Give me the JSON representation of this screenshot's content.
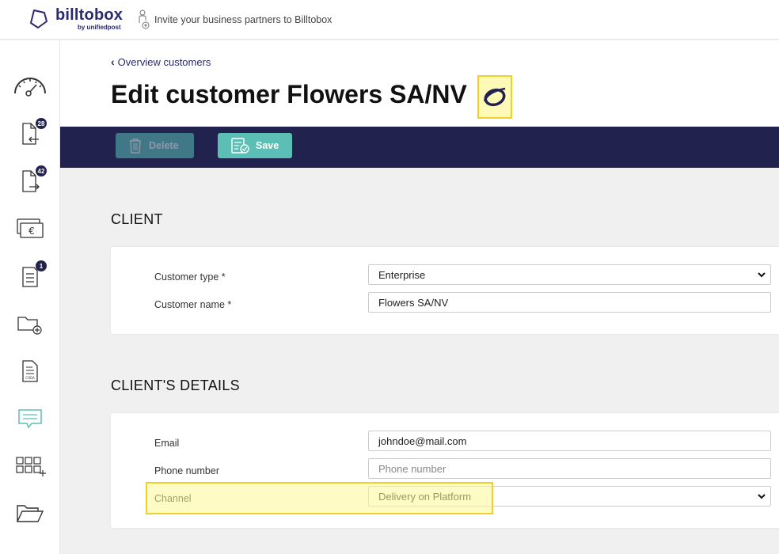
{
  "brand": {
    "name": "billtobox",
    "sub": "by unifiedpost"
  },
  "invite": {
    "text": "Invite your business partners to Billtobox"
  },
  "sidebar": {
    "items": [
      {
        "name": "dashboard",
        "badge": ""
      },
      {
        "name": "incoming-documents",
        "badge": "28"
      },
      {
        "name": "outgoing-documents",
        "badge": "42"
      },
      {
        "name": "payments",
        "badge": ""
      },
      {
        "name": "tasks",
        "badge": "1"
      },
      {
        "name": "add-folder",
        "badge": ""
      },
      {
        "name": "coda-document",
        "badge": ""
      },
      {
        "name": "messages",
        "badge": ""
      },
      {
        "name": "apps",
        "badge": ""
      },
      {
        "name": "archive",
        "badge": ""
      }
    ]
  },
  "page": {
    "breadcrumb": "Overview customers",
    "title": "Edit customer Flowers SA/NV"
  },
  "toolbar": {
    "delete_label": "Delete",
    "save_label": "Save"
  },
  "client": {
    "section_title": "CLIENT",
    "customer_type_label": "Customer type *",
    "customer_type_value": "Enterprise",
    "customer_name_label": "Customer name *",
    "customer_name_value": "Flowers SA/NV"
  },
  "details": {
    "section_title": "CLIENT'S DETAILS",
    "email_label": "Email",
    "email_value": "johndoe@mail.com",
    "phone_label": "Phone number",
    "phone_placeholder": "Phone number",
    "channel_label": "Channel",
    "channel_value": "Delivery on Platform"
  },
  "colors": {
    "navy": "#22224f",
    "teal": "#5bbfb5",
    "highlight": "#f2d02a"
  }
}
